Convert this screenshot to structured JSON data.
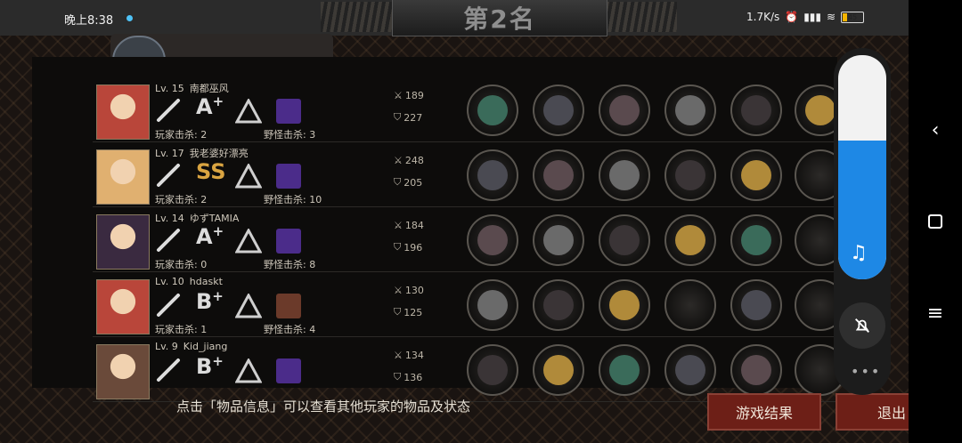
{
  "status_bar": {
    "time": "晚上8:38",
    "speed": "1.7K/s",
    "battery": "45"
  },
  "header": {
    "rank_title": "第2名"
  },
  "players": [
    {
      "level": "Lv. 15",
      "name": "南都巫风",
      "grade": "A",
      "grade_sup": "+",
      "player_kills": "玩家击杀: 2",
      "monster_kills": "野怪击杀: 3",
      "attack": "189",
      "defense": "227",
      "items": [
        "tangled-vines-item",
        "iron-helm-item",
        "shoulder-armor-item",
        "mech-bracer-item",
        "dark-gauntlet-item",
        "golden-staff-item"
      ]
    },
    {
      "level": "Lv. 17",
      "name": "我老婆好漂亮",
      "grade": "SS",
      "grade_sup": "",
      "player_kills": "玩家击杀: 2",
      "monster_kills": "野怪击杀: 10",
      "attack": "248",
      "defense": "205",
      "items": [
        "great-sword-item",
        "knight-helm-item",
        "red-armor-item",
        "blade-item",
        "dark-gauntlet-item",
        "empty-slot"
      ]
    },
    {
      "level": "Lv. 14",
      "name": "ゆずTAMIA",
      "grade": "A",
      "grade_sup": "+",
      "player_kills": "玩家击杀: 0",
      "monster_kills": "野怪击杀: 8",
      "attack": "184",
      "defense": "196",
      "items": [
        "crimson-sword-item",
        "royal-crown-item",
        "plate-armor-item",
        "golden-shield-item",
        "dark-boots-item",
        "empty-slot"
      ]
    },
    {
      "level": "Lv. 10",
      "name": "hdaskt",
      "grade": "B",
      "grade_sup": "+",
      "player_kills": "玩家击杀: 1",
      "monster_kills": "野怪击杀: 4",
      "attack": "130",
      "defense": "125",
      "items": [
        "light-saber-item",
        "dark-helm-item",
        "red-cape-item",
        "empty-slot",
        "grey-shoes-item",
        "empty-slot"
      ]
    },
    {
      "level": "Lv. 9",
      "name": "Kid_jiang",
      "grade": "B",
      "grade_sup": "+",
      "player_kills": "",
      "monster_kills": "",
      "attack": "134",
      "defense": "136",
      "items": [
        "great-sword-item",
        "white-mask-item",
        "red-armor-item",
        "blade-item",
        "red-heels-item",
        "empty-slot"
      ]
    }
  ],
  "footer": {
    "tip": "点击「物品信息」可以查看其他玩家的物品及状态",
    "result_button": "游戏结果",
    "exit_button": "退出"
  },
  "volume": {
    "level": 0.62
  },
  "colors": {
    "accent_red": "#6d1f17",
    "volume_blue": "#1e88e5",
    "item_palette": [
      "#3a6b5a",
      "#4a4a52",
      "#5a4a4e",
      "#6a6a6a",
      "#3a3436",
      "#b08a3a"
    ]
  }
}
